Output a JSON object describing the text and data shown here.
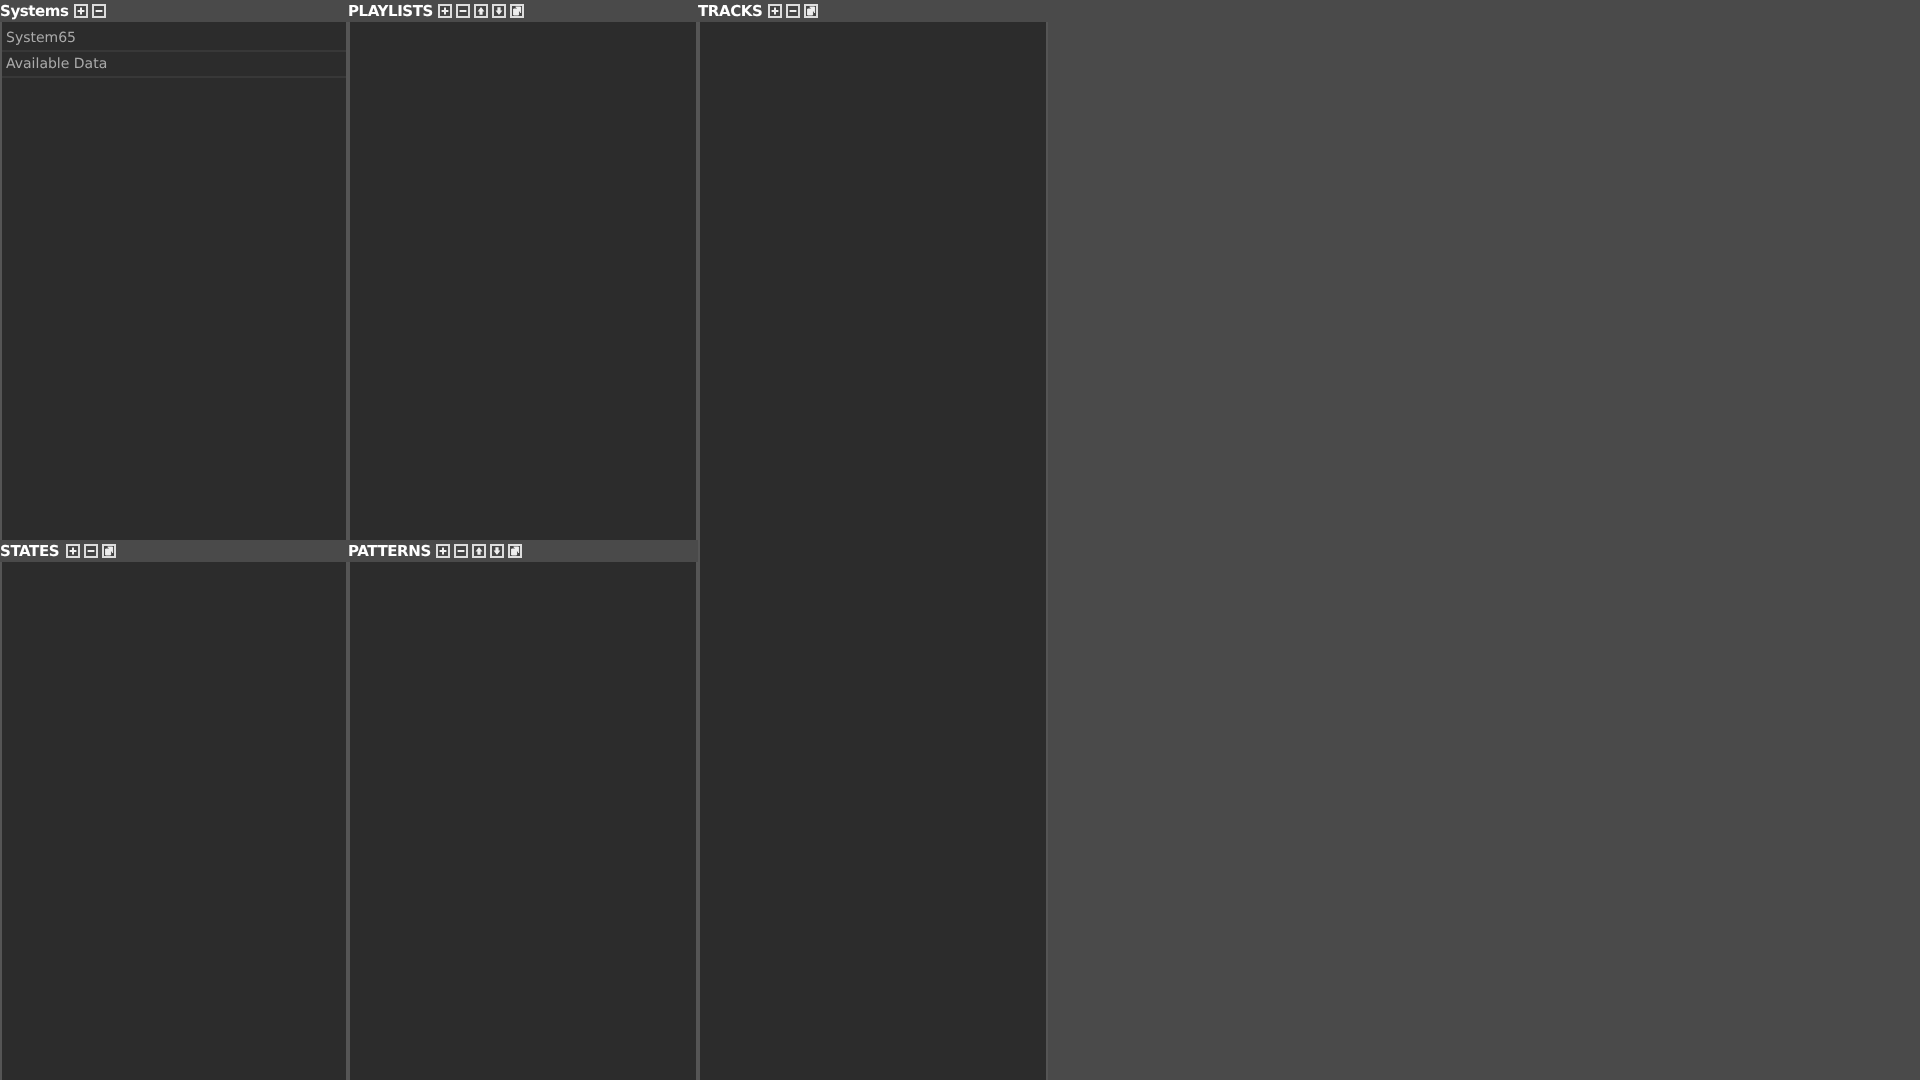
{
  "panels": [
    {
      "title": "Systems",
      "buttons": [
        {
          "kind": "add"
        },
        {
          "kind": "remove"
        }
      ],
      "items": [
        {
          "label": "System65"
        },
        {
          "label": "Available Data"
        }
      ]
    },
    {
      "title": "PLAYLISTS",
      "buttons": [
        {
          "kind": "add"
        },
        {
          "kind": "remove"
        },
        {
          "kind": "up"
        },
        {
          "kind": "down"
        },
        {
          "kind": "copy"
        }
      ]
    },
    {
      "title": "TRACKS",
      "buttons": [
        {
          "kind": "add"
        },
        {
          "kind": "remove"
        },
        {
          "kind": "copy"
        }
      ]
    },
    {
      "title": "STATES",
      "buttons": [
        {
          "kind": "add"
        },
        {
          "kind": "remove"
        },
        {
          "kind": "copy"
        }
      ]
    },
    {
      "title": "PATTERNS",
      "buttons": [
        {
          "kind": "add"
        },
        {
          "kind": "remove"
        },
        {
          "kind": "up"
        },
        {
          "kind": "down"
        },
        {
          "kind": "copy"
        }
      ]
    }
  ]
}
